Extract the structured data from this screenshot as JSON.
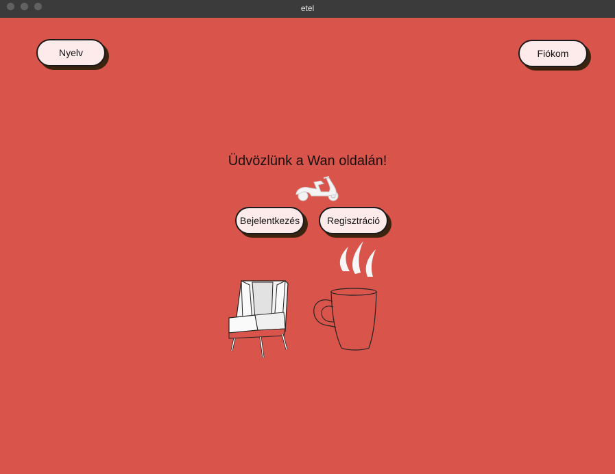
{
  "window": {
    "title": "etel"
  },
  "header": {
    "language_label": "Nyelv",
    "account_label": "Fiókom"
  },
  "main": {
    "welcome": "Üdvözlünk a Wan oldalán!",
    "login_label": "Bejelentkezés",
    "register_label": "Regisztráció"
  },
  "icons": {
    "scooter": "scooter-icon",
    "armchair": "armchair-icon",
    "mug": "coffee-mug-icon"
  },
  "colors": {
    "background": "#d9544a",
    "button_fill": "#fdeaea",
    "button_shadow": "#3a2410"
  }
}
